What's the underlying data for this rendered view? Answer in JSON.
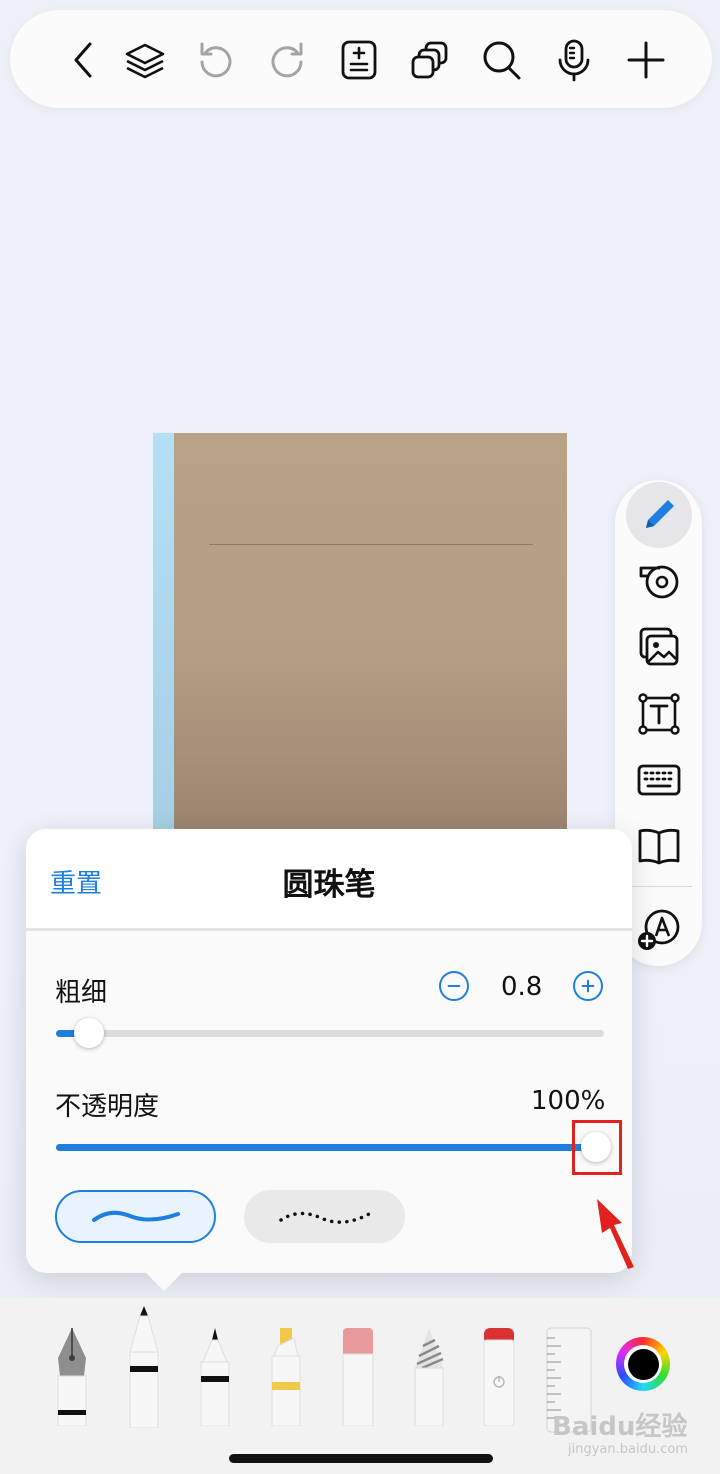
{
  "top_toolbar": {
    "icons": [
      "back-icon",
      "layers-icon",
      "undo-icon",
      "redo-icon",
      "page-settings-icon",
      "duplicate-icon",
      "search-icon",
      "microphone-icon",
      "add-icon"
    ]
  },
  "side_panel": {
    "tools": [
      "pen-tool-icon",
      "tape-icon",
      "image-icon",
      "text-box-icon",
      "keyboard-icon",
      "book-icon",
      "add-sticker-icon"
    ],
    "active_tool": "pen-tool-icon"
  },
  "pen_settings": {
    "reset_label": "重置",
    "title": "圆珠笔",
    "thickness": {
      "label": "粗细",
      "value": "0.8",
      "slider_fraction": 0.06
    },
    "opacity": {
      "label": "不透明度",
      "value": "100%",
      "slider_fraction": 1.0
    },
    "stroke_styles": [
      "solid-stroke",
      "dotted-stroke"
    ],
    "selected_style": "solid-stroke"
  },
  "pen_tray": {
    "tools": [
      "fountain-pen",
      "ballpoint-pen",
      "fineliner-pen",
      "highlighter",
      "eraser-soft",
      "pencil",
      "eraser",
      "ruler"
    ],
    "selected_tool": "ballpoint-pen",
    "current_color": "#000000"
  },
  "colors": {
    "accent": "#1f7fde",
    "annotation": "#e0231f"
  },
  "watermark": {
    "logo": "Baidu经验",
    "site": "jingyan.baidu.com"
  }
}
